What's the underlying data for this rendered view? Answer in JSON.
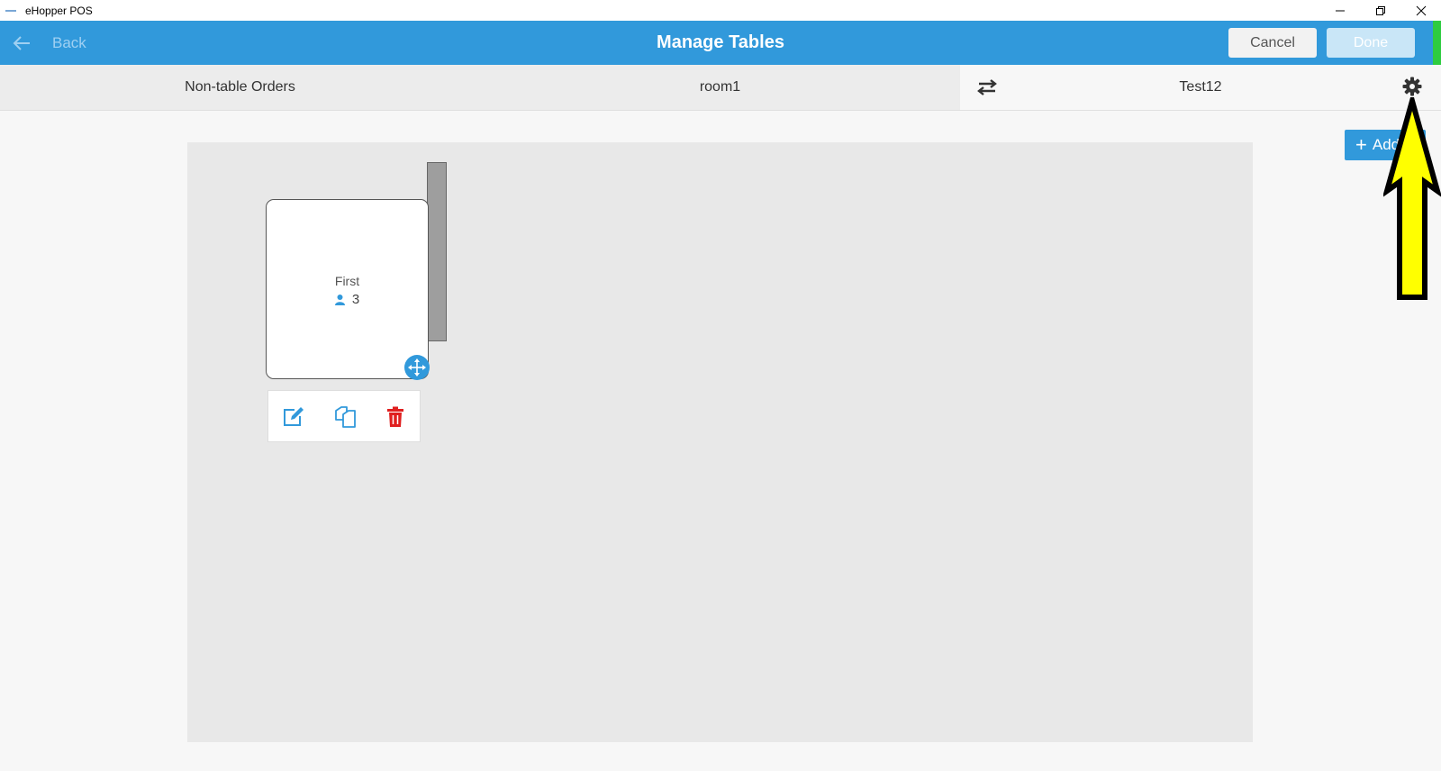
{
  "window": {
    "title": "eHopper POS"
  },
  "header": {
    "back_label": "Back",
    "title": "Manage Tables",
    "cancel_label": "Cancel",
    "done_label": "Done"
  },
  "tabs": [
    {
      "label": "Non-table Orders"
    },
    {
      "label": "room1"
    },
    {
      "label": "Test12"
    }
  ],
  "canvas": {
    "table": {
      "name": "First",
      "seats": "3"
    }
  },
  "add_button": {
    "label": "Add"
  },
  "colors": {
    "header_bg": "#3199db",
    "delete_icon": "#e02020",
    "annotation_arrow": "#ffff00"
  }
}
